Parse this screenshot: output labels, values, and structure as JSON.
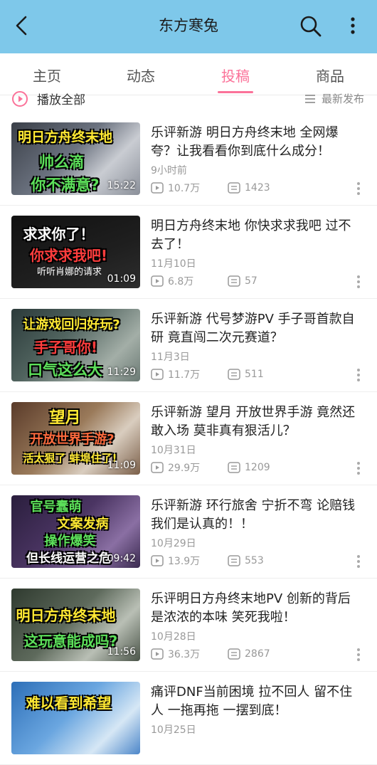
{
  "header": {
    "title": "东方寒兔"
  },
  "tabs": [
    {
      "label": "主页"
    },
    {
      "label": "动态"
    },
    {
      "label": "投稿"
    },
    {
      "label": "商品"
    }
  ],
  "playbar": {
    "play_all": "播放全部",
    "sort": "最新发布"
  },
  "videos": [
    {
      "title": "乐评新游 明日方舟终末地 全网爆夸？让我看看你到底什么成分！",
      "date": "9小时前",
      "views": "10.7万",
      "comments": "1423",
      "duration": "15:22",
      "captions": [
        "明日方舟终末地",
        "帅么滴",
        "你不满意?"
      ]
    },
    {
      "title": "明日方舟终末地 你快求求我吧 过不去了！",
      "date": "11月10日",
      "views": "6.8万",
      "comments": "57",
      "duration": "01:09",
      "captions": [
        "求求你了！",
        "你求求我吧!",
        "听听肖娜的请求"
      ]
    },
    {
      "title": "乐评新游 代号梦游PV 手子哥首款自研 竟直闯二次元赛道？",
      "date": "11月3日",
      "views": "11.7万",
      "comments": "511",
      "duration": "11:29",
      "captions": [
        "让游戏回归好玩?",
        "手子哥你!",
        "口气这么大"
      ]
    },
    {
      "title": "乐评新游 望月 开放世界手游 竟然还敢入场 莫非真有狠活儿？",
      "date": "10月31日",
      "views": "29.9万",
      "comments": "1209",
      "duration": "11:09",
      "captions": [
        "望月",
        "开放世界手游?",
        "活太狠了 蚌埠住了!"
      ]
    },
    {
      "title": "乐评新游 环行旅舍 宁折不弯 论赔钱我们是认真的！！",
      "date": "10月29日",
      "views": "13.9万",
      "comments": "553",
      "duration": "09:42",
      "captions": [
        "官号蠢萌",
        "文案发病",
        "操作爆笑",
        "但长线运营之危"
      ]
    },
    {
      "title": "乐评明日方舟终末地PV 创新的背后是浓浓的本味 笑死我啦！",
      "date": "10月28日",
      "views": "36.3万",
      "comments": "2867",
      "duration": "11:56",
      "captions": [
        "明日方舟终末地",
        "这玩意能成吗?"
      ]
    },
    {
      "title": "痛评DNF当前困境 拉不回人 留不住人 一拖再拖 一摆到底！",
      "date": "10月25日",
      "views": "",
      "comments": "",
      "duration": "",
      "captions": [
        "难以看到希望"
      ]
    }
  ],
  "colors": {
    "header_bg": "#7ec8ea",
    "accent": "#fb7299"
  },
  "icons": {
    "back": "chevron-left-icon",
    "search": "search-icon",
    "more": "more-vertical-icon",
    "play": "play-circle-icon",
    "sort": "list-icon"
  }
}
